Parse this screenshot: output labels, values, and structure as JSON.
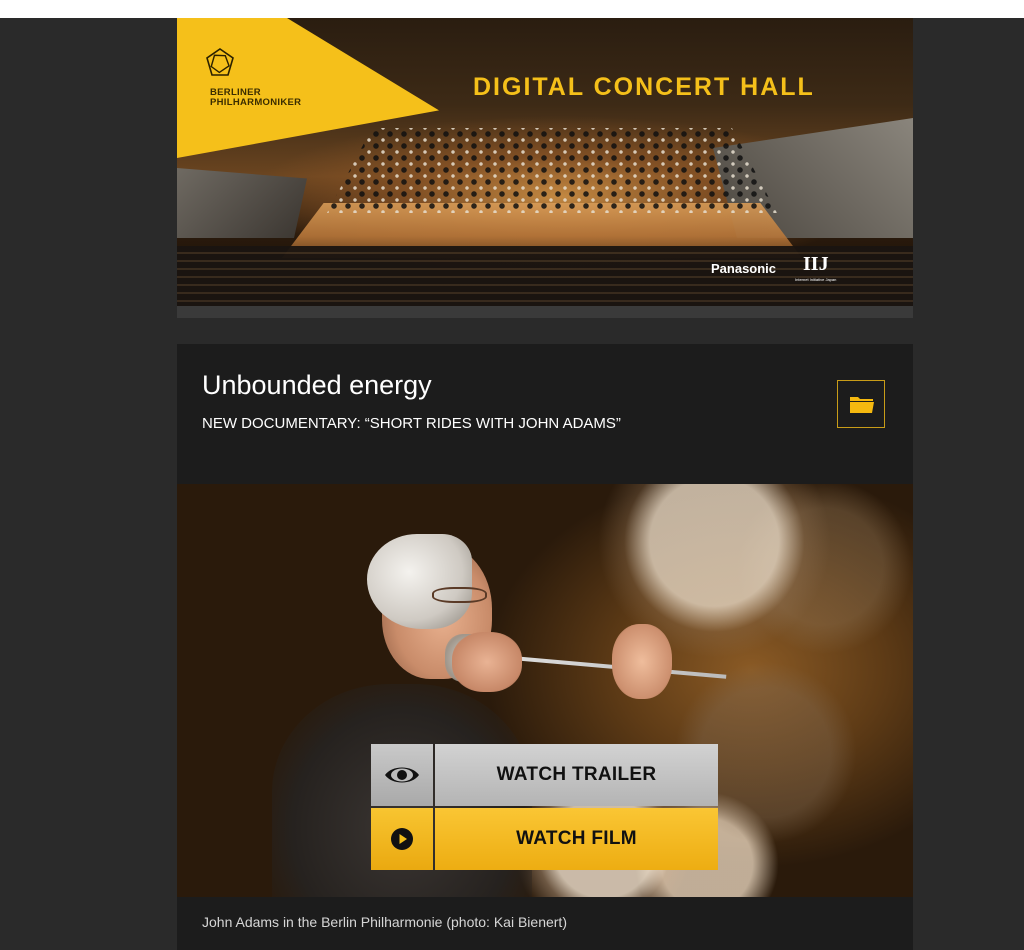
{
  "banner": {
    "logo_line1": "BERLINER",
    "logo_line2": "PHILHARMONIKER",
    "title": "DIGITAL CONCERT HALL",
    "sponsor1": "Panasonic",
    "sponsor2": "IIJ",
    "sponsor2_sub": "Internet Initiative Japan",
    "accent_color": "#f5c01a"
  },
  "card": {
    "title": "Unbounded energy",
    "subtitle": "NEW DOCUMENTARY: “SHORT RIDES WITH JOHN ADAMS”",
    "folder_icon": "folder-icon",
    "buttons": {
      "trailer": {
        "label": "WATCH TRAILER",
        "icon": "eye-icon"
      },
      "film": {
        "label": "WATCH FILM",
        "icon": "play-icon"
      }
    },
    "caption": "John Adams in the Berlin Philharmonie (photo: Kai Bienert)"
  }
}
